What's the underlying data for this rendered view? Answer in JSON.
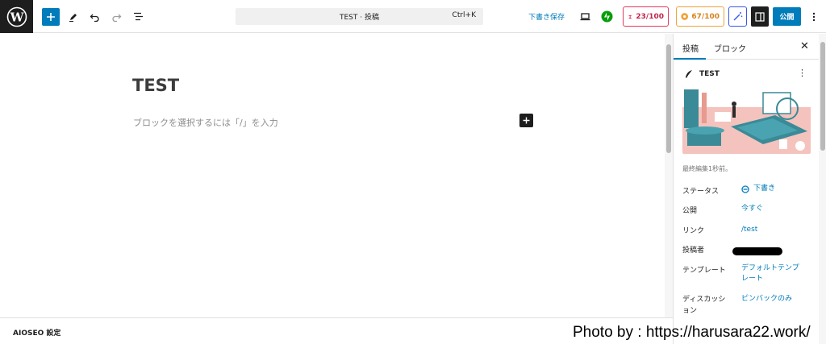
{
  "toolbar": {
    "command_title": "TEST · 投稿",
    "command_shortcut": "Ctrl+K",
    "save_draft_label": "下書き保存",
    "seo_score": "23/100",
    "readability_score": "67/100",
    "publish_label": "公開"
  },
  "editor": {
    "title": "TEST",
    "placeholder": "ブロックを選択するには「/」を入力"
  },
  "meta_box": {
    "label": "AIOSEO 設定"
  },
  "sidebar": {
    "tabs": [
      "投稿",
      "ブロック"
    ],
    "post_title": "TEST",
    "last_edited": "最終編集1秒前。",
    "rows": [
      {
        "label": "ステータス",
        "value": "下書き"
      },
      {
        "label": "公開",
        "value": "今すぐ"
      },
      {
        "label": "リンク",
        "value": "/test"
      },
      {
        "label": "投稿者",
        "value": ""
      },
      {
        "label": "テンプレート",
        "value": "デフォルトテンプレート"
      },
      {
        "label": "ディスカッション",
        "value": "ピンバックのみ"
      }
    ]
  },
  "watermark": "Photo by : https://harusara22.work/",
  "colors": {
    "accent": "#007cba",
    "seo_red": "#e5375d",
    "readability_orange": "#f0a23a",
    "jetpack_green": "#069e08"
  }
}
